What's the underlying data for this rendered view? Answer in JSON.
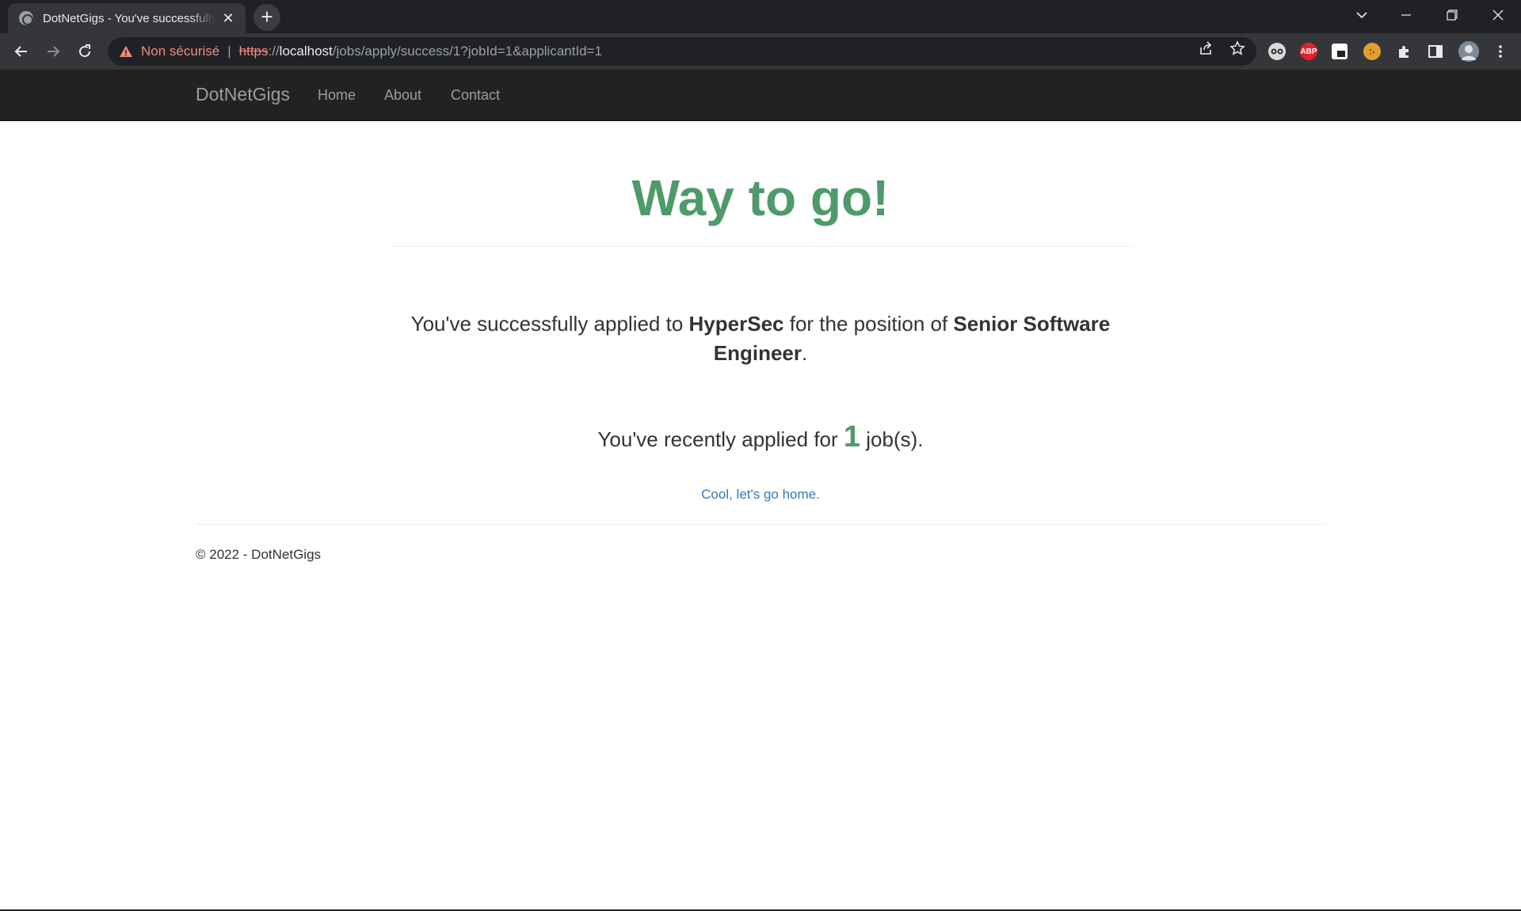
{
  "browser": {
    "tab_title": "DotNetGigs - You've successfully applied",
    "tab_close": "✕",
    "new_tab": "+",
    "security_label": "Non sécurisé",
    "url_scheme": "https",
    "url_sep": "://",
    "url_host": "localhost",
    "url_path": "/jobs/apply/success/1?jobId=1&applicantId=1",
    "ext_abp": "ABP"
  },
  "nav": {
    "brand": "DotNetGigs",
    "links": [
      "Home",
      "About",
      "Contact"
    ]
  },
  "page": {
    "heading": "Way to go!",
    "msg_prefix": "You've successfully applied to ",
    "company": "HyperSec",
    "msg_middle": " for the position of ",
    "position": "Senior Software Engineer",
    "msg_suffix": ".",
    "count_prefix": "You've recently applied for ",
    "count": "1",
    "count_suffix": " job(s).",
    "home_link": "Cool, let's go home."
  },
  "footer": {
    "copyright": "© 2022 - DotNetGigs"
  },
  "colors": {
    "accent_green": "#4e9a6a",
    "link_blue": "#337ab7",
    "navbar_bg": "#222222"
  }
}
